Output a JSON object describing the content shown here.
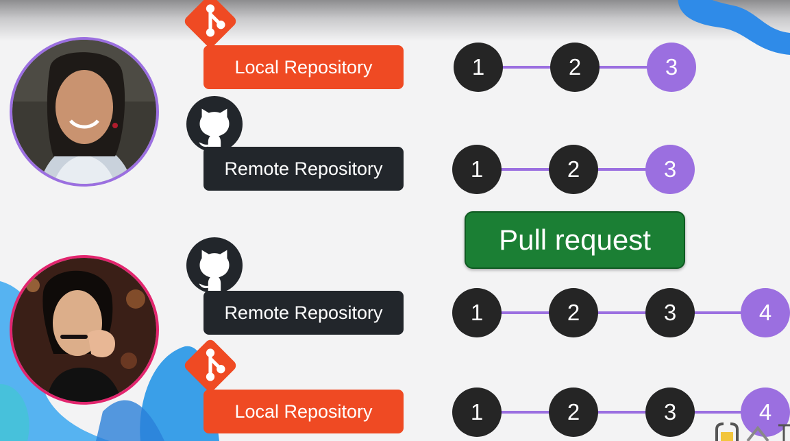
{
  "colors": {
    "local_repo": "#ef4a23",
    "remote_repo": "#22262b",
    "commit": "#252525",
    "commit_new": "#9b6fe0",
    "link_line": "#9b6fe0",
    "pull_request": "#1b7f34",
    "avatar_1_ring": "#9b6fe0",
    "avatar_2_ring": "#e2256e"
  },
  "icons": {
    "git": "git-logo-icon",
    "github": "github-octocat-icon"
  },
  "rows": [
    {
      "icon": "git",
      "label": "Local Repository",
      "commits": [
        "1",
        "2",
        "3"
      ],
      "new_count": 1
    },
    {
      "icon": "github",
      "label": "Remote Repository",
      "commits": [
        "1",
        "2",
        "3"
      ],
      "new_count": 1
    },
    {
      "icon": "github",
      "label": "Remote Repository",
      "commits": [
        "1",
        "2",
        "3",
        "4"
      ],
      "new_count": 1
    },
    {
      "icon": "git",
      "label": "Local Repository",
      "commits": [
        "1",
        "2",
        "3",
        "4"
      ],
      "new_count": 1
    }
  ],
  "pull_request": {
    "label": "Pull request"
  }
}
